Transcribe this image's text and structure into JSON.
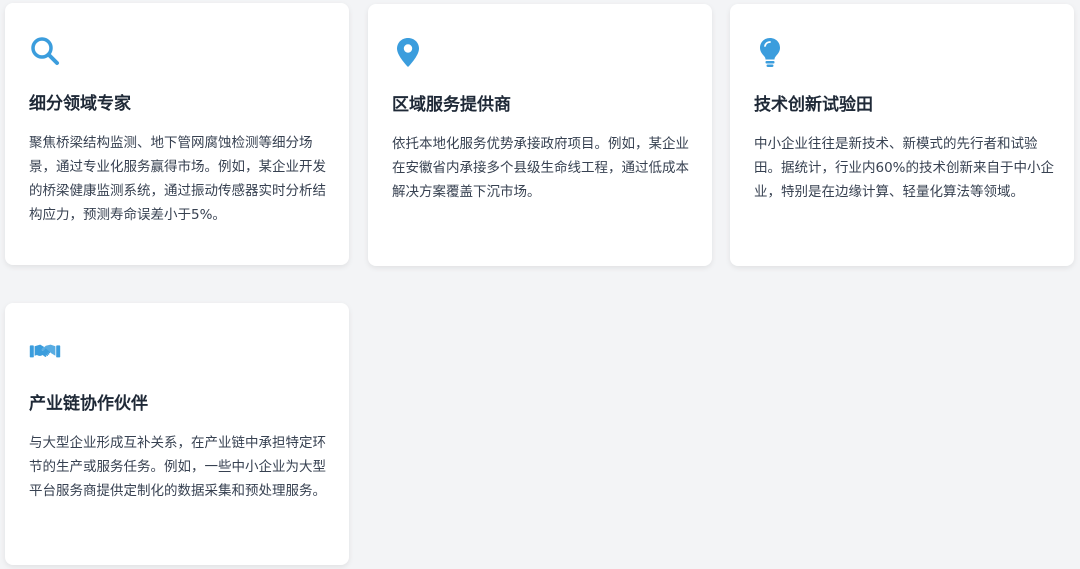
{
  "cards": [
    {
      "icon": "search-icon",
      "title": "细分领域专家",
      "description": "聚焦桥梁结构监测、地下管网腐蚀检测等细分场景，通过专业化服务赢得市场。例如，某企业开发的桥梁健康监测系统，通过振动传感器实时分析结构应力，预测寿命误差小于5%。"
    },
    {
      "icon": "location-pin-icon",
      "title": "区域服务提供商",
      "description": "依托本地化服务优势承接政府项目。例如，某企业在安徽省内承接多个县级生命线工程，通过低成本解决方案覆盖下沉市场。"
    },
    {
      "icon": "lightbulb-icon",
      "title": "技术创新试验田",
      "description": "中小企业往往是新技术、新模式的先行者和试验田。据统计，行业内60%的技术创新来自于中小企业，特别是在边缘计算、轻量化算法等领域。"
    },
    {
      "icon": "handshake-icon",
      "title": "产业链协作伙伴",
      "description": "与大型企业形成互补关系，在产业链中承担特定环节的生产或服务任务。例如，一些中小企业为大型平台服务商提供定制化的数据采集和预处理服务。"
    }
  ],
  "colors": {
    "accent": "#3b9ddd",
    "background": "#f3f4f6",
    "card": "#ffffff",
    "title": "#1f2937",
    "text": "#374151"
  }
}
